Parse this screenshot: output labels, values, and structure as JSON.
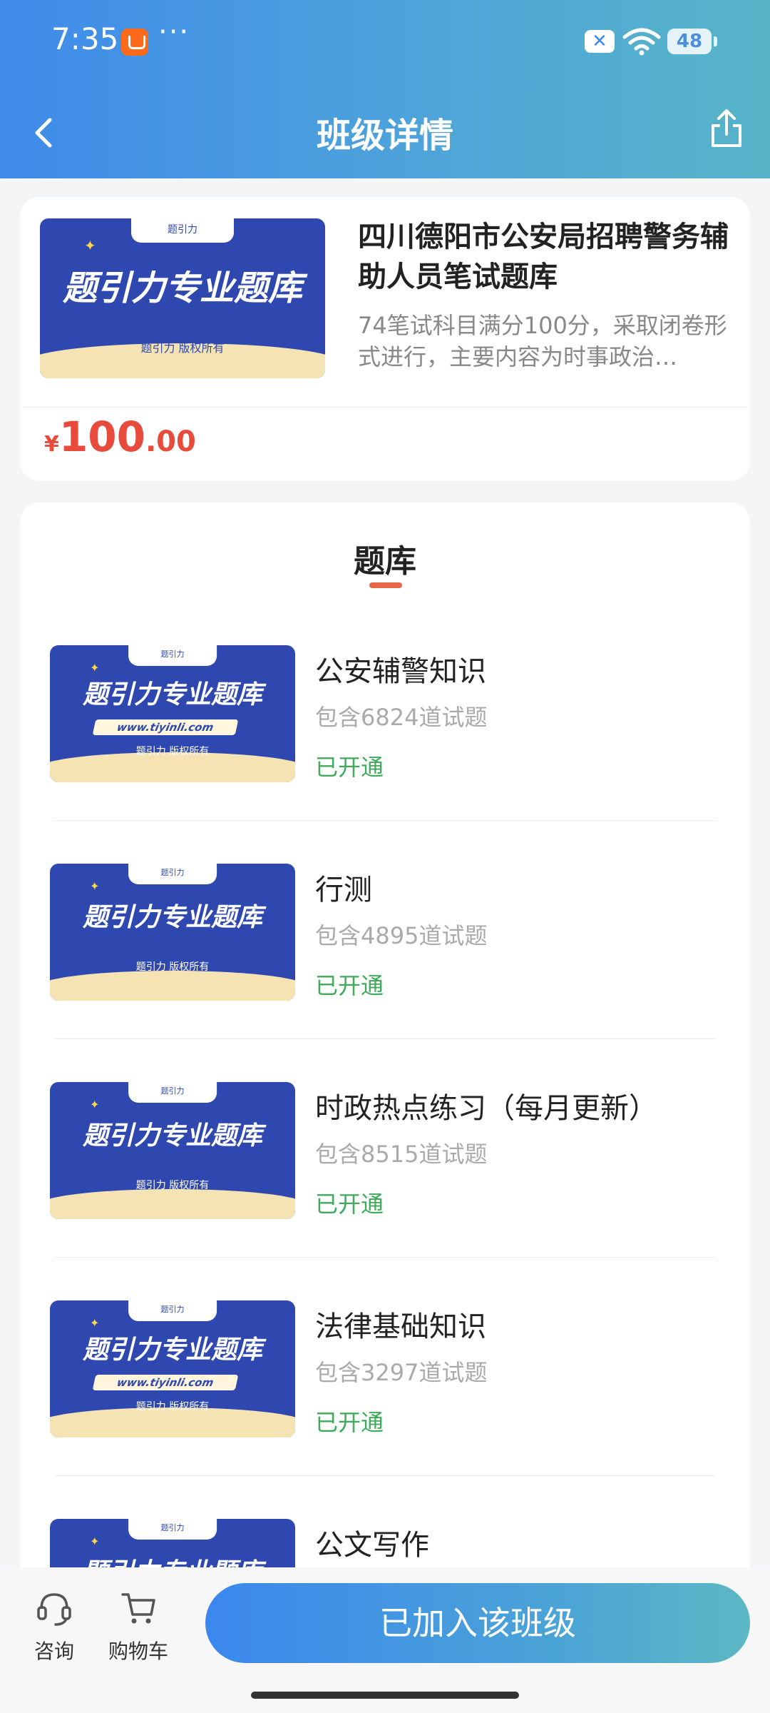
{
  "status_bar": {
    "time": "7:35",
    "dots": "···",
    "battery": "48"
  },
  "header": {
    "title": "班级详情"
  },
  "course": {
    "banner_title": "题引力专业题库",
    "banner_tab": "题引力",
    "banner_sub": "题引力 版权所有",
    "title": "四川德阳市公安局招聘警务辅助人员笔试题库",
    "description": "74笔试科目满分100分，采取闭卷形式进行，主要内容为时事政治…",
    "price_symbol": "¥",
    "price_int": "100",
    "price_dec": ".00"
  },
  "bank_section": {
    "title": "题库",
    "items": [
      {
        "name": "公安辅警知识",
        "count": "包含6824道试题",
        "status": "已开通",
        "banner_title": "题引力专业题库",
        "banner_url": "www.tiyinli.com",
        "banner_sub": "题引力 版权所有",
        "banner_tab": "题引力"
      },
      {
        "name": "行测",
        "count": "包含4895道试题",
        "status": "已开通",
        "banner_title": "题引力专业题库",
        "banner_sub": "题引力 版权所有",
        "banner_tab": "题引力"
      },
      {
        "name": "时政热点练习（每月更新）",
        "count": "包含8515道试题",
        "status": "已开通",
        "banner_title": "题引力专业题库",
        "banner_sub": "题引力 版权所有",
        "banner_tab": "题引力"
      },
      {
        "name": "法律基础知识",
        "count": "包含3297道试题",
        "status": "已开通",
        "banner_title": "题引力专业题库",
        "banner_url": "www.tiyinli.com",
        "banner_sub": "题引力 版权所有",
        "banner_tab": "题引力"
      },
      {
        "name": "公文写作",
        "banner_title": "题引力专业题库",
        "banner_tab": "题引力"
      }
    ]
  },
  "bottom_bar": {
    "consult_label": "咨询",
    "cart_label": "购物车",
    "join_label": "已加入该班级"
  },
  "colors": {
    "header_gradient_start": "#3f8bea",
    "header_gradient_end": "#57b4c8",
    "price_red": "#e84a3c",
    "status_green": "#3dab59",
    "banner_blue": "#2e48b0"
  }
}
